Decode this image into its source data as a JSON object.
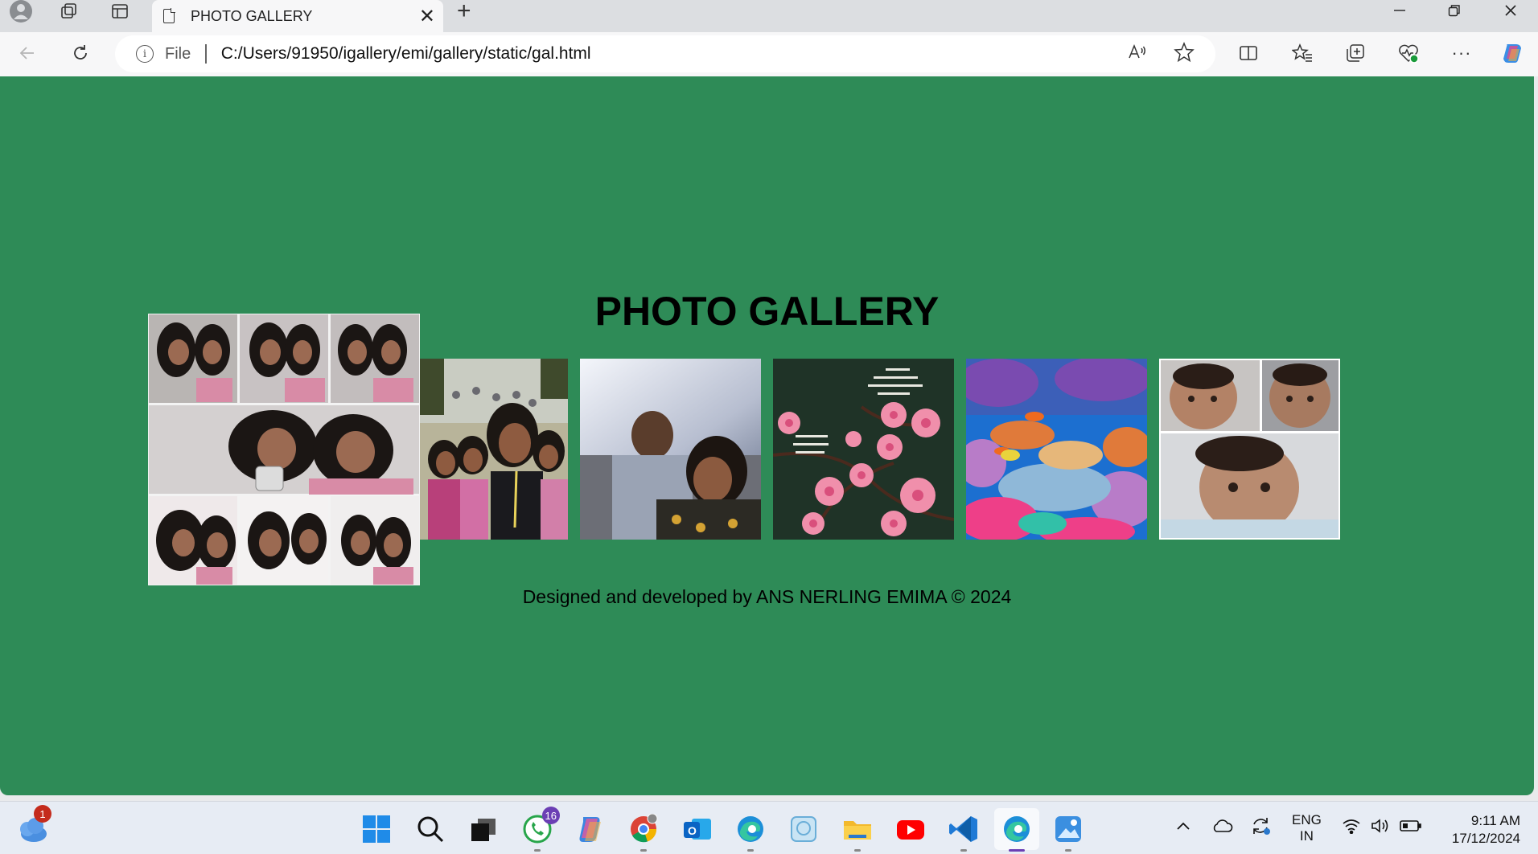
{
  "browser": {
    "tab_title": "PHOTO GALLERY",
    "new_tab_symbol": "+",
    "close_symbol": "✕",
    "address": {
      "scheme_label": "File",
      "url": "C:/Users/91950/igallery/emi/gallery/static/gal.html"
    }
  },
  "page": {
    "background": "#2e8b57",
    "heading": "PHOTO GALLERY",
    "footer": "Designed and developed by ANS NERLING EMIMA © 2024",
    "photos": [
      {
        "name": "selfie-collage"
      },
      {
        "name": "group-selfie"
      },
      {
        "name": "beach-selfie"
      },
      {
        "name": "cherry-blossom-verse"
      },
      {
        "name": "coral-reef"
      },
      {
        "name": "baby-collage"
      }
    ]
  },
  "taskbar": {
    "weather_badge": "1",
    "whatsapp_badge": "16",
    "apps": [
      "start-icon",
      "search-icon",
      "task-view-icon",
      "whatsapp-icon",
      "copilot-icon",
      "chrome-icon",
      "outlook-icon",
      "edge-icon",
      "app-icon",
      "file-explorer-icon",
      "youtube-icon",
      "vscode-icon",
      "edge-active-icon",
      "photos-icon"
    ],
    "language": {
      "line1": "ENG",
      "line2": "IN"
    },
    "time": "9:11 AM",
    "date": "17/12/2024"
  }
}
